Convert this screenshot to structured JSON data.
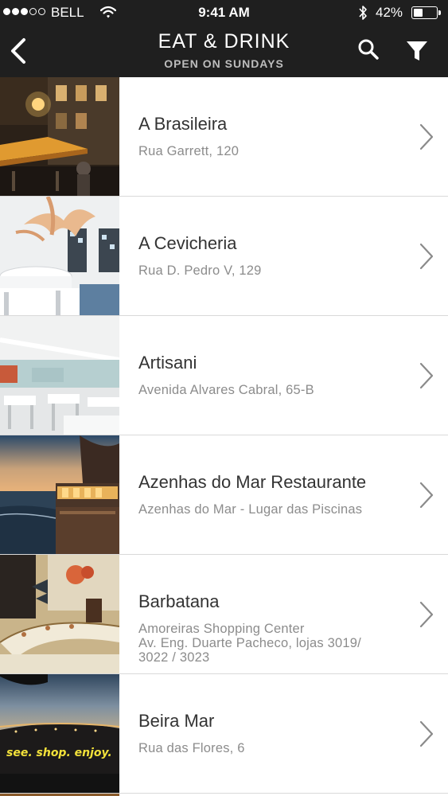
{
  "status_bar": {
    "carrier": "BELL",
    "time": "9:41 AM",
    "battery_percent": "42%",
    "battery_level": 0.42,
    "signal_bars_filled": 3,
    "signal_bars_total": 5
  },
  "nav": {
    "title": "EAT & DRINK",
    "subtitle": "OPEN ON SUNDAYS",
    "back_icon": "chevron-left-icon",
    "search_icon": "search-icon",
    "filter_icon": "filter-icon"
  },
  "colors": {
    "header_bg": "#1f1f1f",
    "name_text": "#333333",
    "address_text": "#8c8c8c",
    "divider": "#d9d9d9"
  },
  "restaurants": [
    {
      "name": "A Brasileira",
      "address": "Rua Garrett, 120"
    },
    {
      "name": "A Cevicheria",
      "address": "Rua D. Pedro V, 129"
    },
    {
      "name": "Artisani",
      "address": "Avenida Alvares Cabral, 65-B"
    },
    {
      "name": "Azenhas do Mar Restaurante",
      "address": "Azenhas do Mar - Lugar das Piscinas"
    },
    {
      "name": "Barbatana",
      "address": "Amoreiras Shopping Center\nAv. Eng. Duarte Pacheco, lojas 3019/\n3022 / 3023"
    },
    {
      "name": "Beira Mar",
      "address": "Rua das Flores, 6",
      "photo_caption": "see. shop. enjoy."
    }
  ]
}
